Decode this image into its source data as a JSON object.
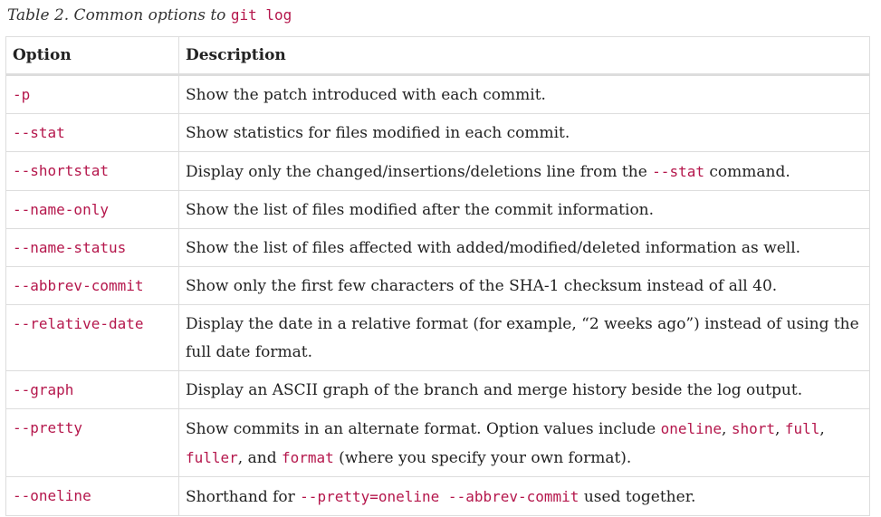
{
  "caption": {
    "prefix": "Table 2. Common options to ",
    "code": "git log"
  },
  "table": {
    "headers": [
      "Option",
      "Description"
    ],
    "rows": [
      {
        "option": "-p",
        "desc": [
          {
            "t": "Show the patch introduced with each commit."
          }
        ]
      },
      {
        "option": "--stat",
        "desc": [
          {
            "t": "Show statistics for files modified in each commit."
          }
        ]
      },
      {
        "option": "--shortstat",
        "desc": [
          {
            "t": "Display only the changed/insertions/deletions line from the "
          },
          {
            "c": "--stat"
          },
          {
            "t": " command."
          }
        ]
      },
      {
        "option": "--name-only",
        "desc": [
          {
            "t": "Show the list of files modified after the commit information."
          }
        ]
      },
      {
        "option": "--name-status",
        "desc": [
          {
            "t": "Show the list of files affected with added/modified/deleted information as well."
          }
        ]
      },
      {
        "option": "--abbrev-commit",
        "desc": [
          {
            "t": "Show only the first few characters of the SHA-1 checksum instead of all 40."
          }
        ]
      },
      {
        "option": "--relative-date",
        "desc": [
          {
            "t": "Display the date in a relative format (for example, “2 weeks ago”) instead of using the full date format."
          }
        ]
      },
      {
        "option": "--graph",
        "desc": [
          {
            "t": "Display an ASCII graph of the branch and merge history beside the log output."
          }
        ]
      },
      {
        "option": "--pretty",
        "desc": [
          {
            "t": "Show commits in an alternate format. Option values include "
          },
          {
            "c": "oneline"
          },
          {
            "t": ", "
          },
          {
            "c": "short"
          },
          {
            "t": ", "
          },
          {
            "c": "full"
          },
          {
            "t": ", "
          },
          {
            "c": "fuller"
          },
          {
            "t": ", and "
          },
          {
            "c": "format"
          },
          {
            "t": " (where you specify your own format)."
          }
        ]
      },
      {
        "option": "--oneline",
        "desc": [
          {
            "t": "Shorthand for "
          },
          {
            "c": "--pretty=oneline --abbrev-commit"
          },
          {
            "t": " used together."
          }
        ]
      }
    ]
  },
  "colors": {
    "code": "#b5174c",
    "border": "#dddddd",
    "text": "#222222"
  }
}
